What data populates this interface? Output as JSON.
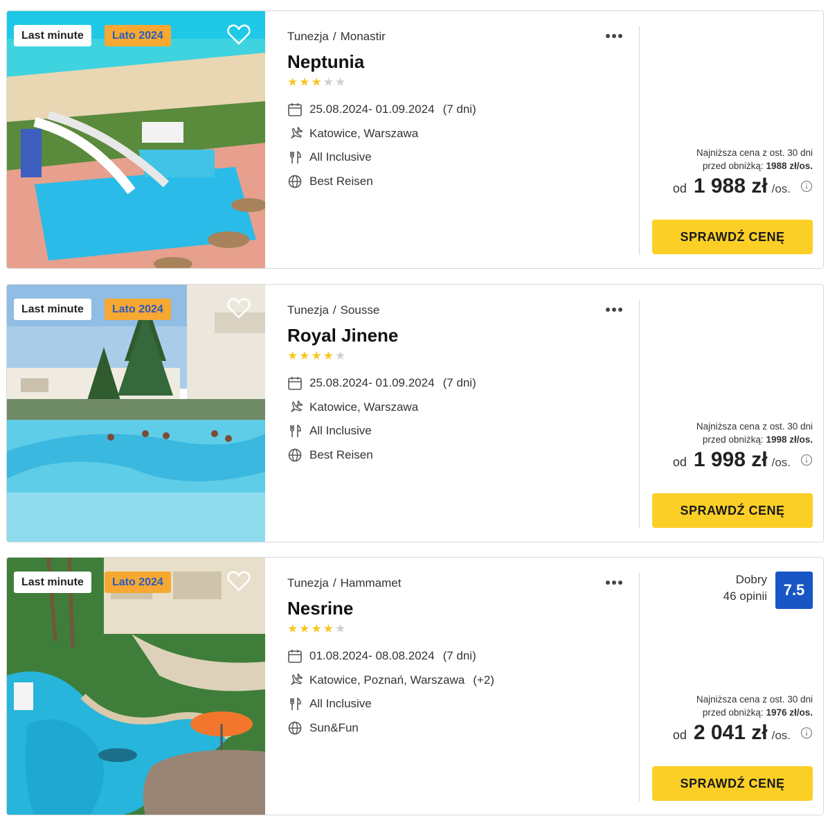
{
  "colors": {
    "accent_yellow": "#fbcf26",
    "season_badge_bg": "#f7a832",
    "season_badge_text": "#2a5bbd",
    "rating_bg": "#1756c4",
    "star_on": "#f7c623",
    "star_off": "#cfcfcf"
  },
  "offers": [
    {
      "badges": {
        "last_minute": "Last minute",
        "season": "Lato 2024"
      },
      "country": "Tunezja",
      "separator": "/",
      "city": "Monastir",
      "name": "Neptunia",
      "stars": 3,
      "dates": "25.08.2024- 01.09.2024",
      "duration": "(7 dni)",
      "departure": "Katowice, Warszawa",
      "departure_extra": "",
      "board": "All Inclusive",
      "operator": "Best Reisen",
      "lowest_line1": "Najniższa cena z ost. 30 dni",
      "lowest_line2_label": "przed obniżką:",
      "lowest_price": "1988 zł/os.",
      "price_prefix": "od",
      "price": "1 988 zł",
      "price_suffix": "/os.",
      "cta": "SPRAWDŹ CENĘ"
    },
    {
      "badges": {
        "last_minute": "Last minute",
        "season": "Lato 2024"
      },
      "country": "Tunezja",
      "separator": "/",
      "city": "Sousse",
      "name": "Royal Jinene",
      "stars": 4,
      "dates": "25.08.2024- 01.09.2024",
      "duration": "(7 dni)",
      "departure": "Katowice, Warszawa",
      "departure_extra": "",
      "board": "All Inclusive",
      "operator": "Best Reisen",
      "lowest_line1": "Najniższa cena z ost. 30 dni",
      "lowest_line2_label": "przed obniżką:",
      "lowest_price": "1998 zł/os.",
      "price_prefix": "od",
      "price": "1 998 zł",
      "price_suffix": "/os.",
      "cta": "SPRAWDŹ CENĘ"
    },
    {
      "badges": {
        "last_minute": "Last minute",
        "season": "Lato 2024"
      },
      "country": "Tunezja",
      "separator": "/",
      "city": "Hammamet",
      "name": "Nesrine",
      "stars": 4,
      "dates": "01.08.2024- 08.08.2024",
      "duration": "(7 dni)",
      "departure": "Katowice, Poznań, Warszawa",
      "departure_extra": "(+2)",
      "board": "All Inclusive",
      "operator": "Sun&Fun",
      "rating_label": "Dobry",
      "rating_count": "46 opinii",
      "rating_score": "7.5",
      "lowest_line1": "Najniższa cena z ost. 30 dni",
      "lowest_line2_label": "przed obniżką:",
      "lowest_price": "1976 zł/os.",
      "price_prefix": "od",
      "price": "2 041 zł",
      "price_suffix": "/os.",
      "cta": "SPRAWDŹ CENĘ"
    }
  ]
}
